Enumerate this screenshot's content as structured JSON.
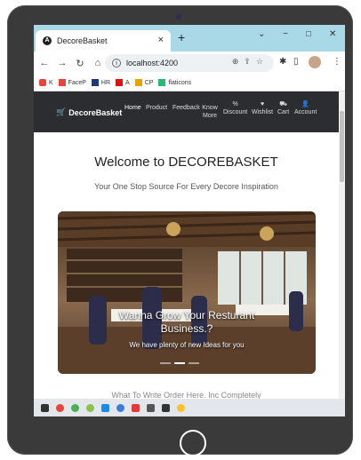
{
  "browser": {
    "tab_title": "DecoreBasket",
    "tab_close": "×",
    "new_tab": "+",
    "window_controls": {
      "dropdown": "⌄",
      "minimize": "−",
      "maximize": "□",
      "close": "✕"
    },
    "url": "localhost:4200",
    "bookmarks": [
      {
        "label": "K",
        "color": "#e8453c"
      },
      {
        "label": "FaceP",
        "color": "#e8453c"
      },
      {
        "label": "HR",
        "color": "#1a3a7a"
      },
      {
        "label": "A",
        "color": "#d11"
      },
      {
        "label": "CP",
        "color": "#e6a400"
      },
      {
        "label": "flaticons",
        "color": "#2bb673"
      }
    ]
  },
  "site": {
    "brand": "DecoreBasket",
    "nav": [
      {
        "label": "Home",
        "active": true
      },
      {
        "label": "Product"
      },
      {
        "label": "Feedback"
      },
      {
        "label": "Know More"
      }
    ],
    "nav_icons": [
      {
        "icon": "percent-icon",
        "glyph": "%",
        "label": "Discount"
      },
      {
        "icon": "heart-icon",
        "glyph": "♥",
        "label": "Wishlist"
      },
      {
        "icon": "cart-icon",
        "glyph": "⛟",
        "label": "Cart"
      },
      {
        "icon": "user-icon",
        "glyph": "👤",
        "label": "Account"
      }
    ],
    "welcome_title": "Welcome to DECOREBASKET",
    "tagline": "Your One Stop Source For Every Decore Inspiration",
    "carousel": {
      "caption_title_line1": "Wanna Grow Your Resturant",
      "caption_title_line2": "Business.?",
      "caption_text": "We have plenty of new Ideas for you",
      "slide_count": 3,
      "active_slide": 2
    },
    "partial_heading": "What To Write Order Here. Inc Completely"
  }
}
